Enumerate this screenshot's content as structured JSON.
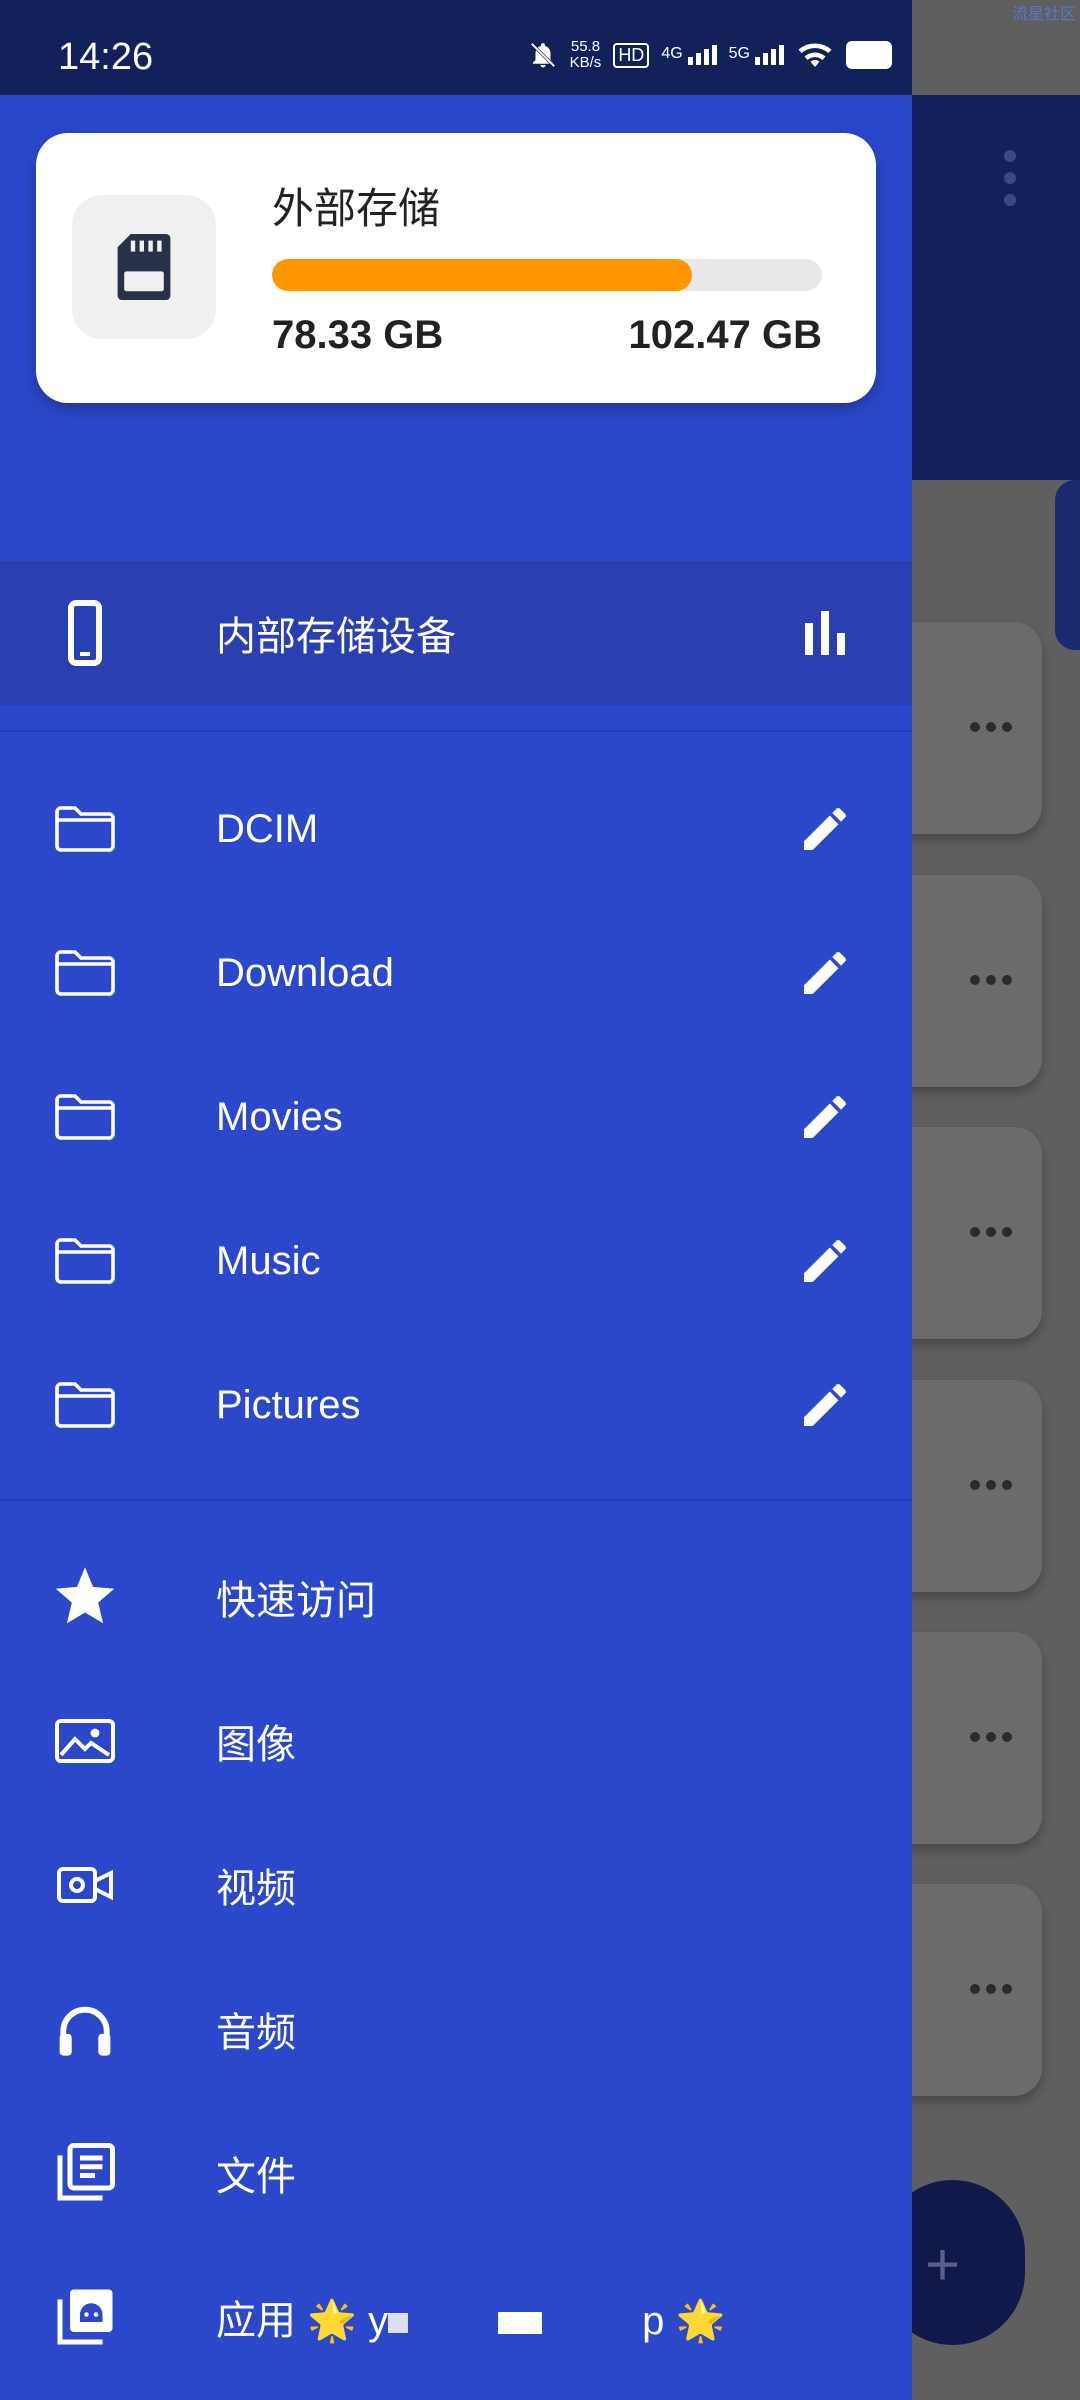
{
  "status_bar": {
    "time": "14:26",
    "net_speed_value": "55.8",
    "net_speed_unit": "KB/s",
    "hd": "HD",
    "sim1": "4G",
    "sim2": "5G",
    "corner_text": "流星社区"
  },
  "storage_card": {
    "title": "外部存储",
    "used": "78.33 GB",
    "total": "102.47 GB",
    "progress_fraction": 0.764,
    "bar_color": "#ff9800"
  },
  "internal_storage": {
    "label": "内部存储设备"
  },
  "folders": [
    {
      "label": "DCIM"
    },
    {
      "label": "Download"
    },
    {
      "label": "Movies"
    },
    {
      "label": "Music"
    },
    {
      "label": "Pictures"
    }
  ],
  "categories": [
    {
      "label": "快速访问",
      "icon": "star-icon"
    },
    {
      "label": "图像",
      "icon": "image-icon"
    },
    {
      "label": "视频",
      "icon": "video-icon"
    },
    {
      "label": "音频",
      "icon": "headphones-icon"
    },
    {
      "label": "文件",
      "icon": "documents-icon"
    },
    {
      "label": "应用",
      "icon": "android-apps-icon"
    }
  ],
  "apps_suffix": {
    "star": "🌟",
    "text_start": "y",
    "text_end": "p",
    "star_end": "🌟"
  },
  "colors": {
    "drawer": "#2b48cb",
    "status": "#12215a",
    "accent": "#ff9800"
  }
}
